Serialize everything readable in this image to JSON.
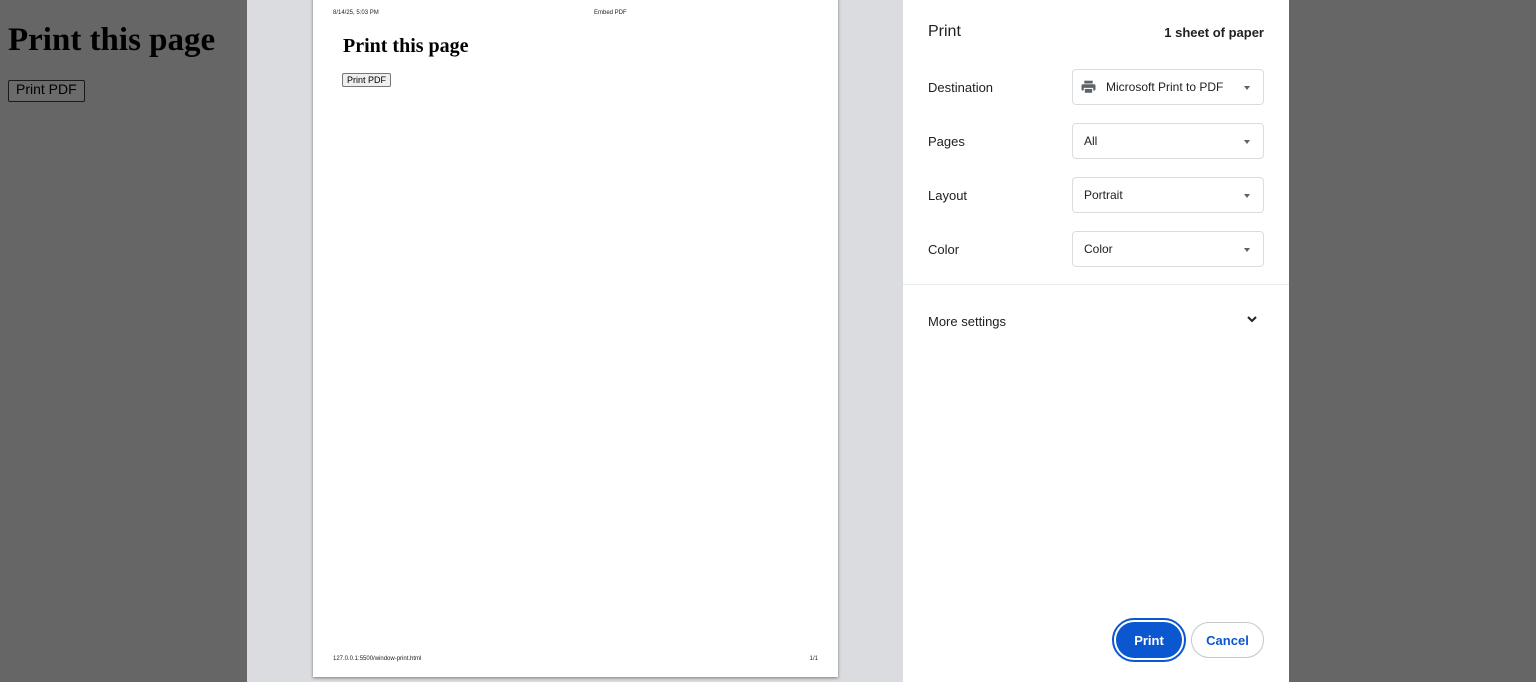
{
  "background_page": {
    "title": "Print this page",
    "button_label": "Print PDF"
  },
  "preview": {
    "header_date": "8/14/25, 5:03 PM",
    "header_title": "Embed PDF",
    "page_title": "Print this page",
    "page_button": "Print PDF",
    "footer_url": "127.0.0.1:5500/window-print.html",
    "footer_page": "1/1"
  },
  "settings": {
    "title": "Print",
    "sheets": "1 sheet of paper",
    "destination": {
      "label": "Destination",
      "value": "Microsoft Print to PDF",
      "icon": "printer-icon"
    },
    "pages": {
      "label": "Pages",
      "value": "All"
    },
    "layout": {
      "label": "Layout",
      "value": "Portrait"
    },
    "color": {
      "label": "Color",
      "value": "Color"
    },
    "more_settings": "More settings",
    "print_button": "Print",
    "cancel_button": "Cancel"
  },
  "colors": {
    "accent": "#0b57d0",
    "overlay": "#666666",
    "preview_bg": "#dadce0"
  }
}
